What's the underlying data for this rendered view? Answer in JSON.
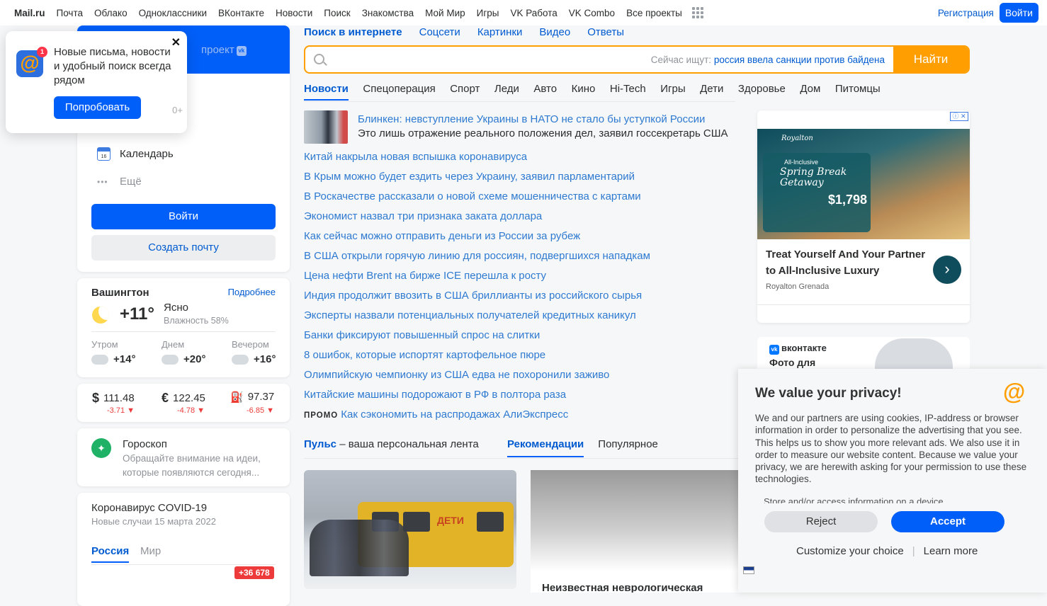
{
  "topnav": {
    "brand": "Mail.ru",
    "items": [
      "Почта",
      "Облако",
      "Одноклассники",
      "ВКонтакте",
      "Новости",
      "Поиск",
      "Знакомства",
      "Мой Мир",
      "Игры",
      "VK Работа",
      "VK Combo",
      "Все проекты"
    ],
    "register": "Регистрация",
    "login": "Войти"
  },
  "mail": {
    "project_label": "проект",
    "calendar": "Календарь",
    "more": "Ещё",
    "login": "Войти",
    "create": "Создать почту"
  },
  "promo_popup": {
    "badge": "1",
    "text": "Новые письма, новости и удобный поиск всегда рядом",
    "button": "Попробовать",
    "age": "0+"
  },
  "weather": {
    "city": "Вашингтон",
    "more": "Подробнее",
    "temp": "+11°",
    "condition": "Ясно",
    "humidity": "Влажность 58%",
    "parts": [
      {
        "label": "Утром",
        "temp": "+14°"
      },
      {
        "label": "Днем",
        "temp": "+20°"
      },
      {
        "label": "Вечером",
        "temp": "+16°"
      }
    ]
  },
  "rates": [
    {
      "symbol": "$",
      "value": "111.48",
      "change": "-3.71 ▼"
    },
    {
      "symbol": "€",
      "value": "122.45",
      "change": "-4.78 ▼"
    },
    {
      "symbol": "⛽",
      "value": "97.37",
      "change": "-6.85 ▼"
    }
  ],
  "horoscope": {
    "title": "Гороскоп",
    "text": "Обращайте внимание на идеи, которые появляются сегодня..."
  },
  "covid": {
    "title": "Коронавирус COVID-19",
    "subtitle": "Новые случаи 15 марта 2022",
    "tab_russia": "Россия",
    "tab_world": "Мир",
    "badge": "+36 678"
  },
  "search": {
    "tabs": [
      "Поиск в интернете",
      "Соцсети",
      "Картинки",
      "Видео",
      "Ответы"
    ],
    "hint_prefix": "Сейчас ищут:",
    "hint_query": "россия ввела санкции против байдена",
    "button": "Найти"
  },
  "categories": [
    "Новости",
    "Спецоперация",
    "Спорт",
    "Леди",
    "Авто",
    "Кино",
    "Hi-Tech",
    "Игры",
    "Дети",
    "Здоровье",
    "Дом",
    "Питомцы"
  ],
  "top_news": {
    "headline": "Блинкен: невступление Украины в НАТО не стало бы уступкой России",
    "description": "Это лишь отражение реального положения дел, заявил госсекретарь США"
  },
  "news": [
    "Китай накрыла новая вспышка коронавируса",
    "В Крым можно будет ездить через Украину, заявил парламентарий",
    "В Роскачестве рассказали о новой схеме мошенничества с картами",
    "Экономист назвал три признака заката доллара",
    "Как сейчас можно отправить деньги из России за рубеж",
    "В США открыли горячую линию для россиян, подвергшихся нападкам",
    "Цена нефти Brent на бирже ICE перешла к росту",
    "Индия продолжит ввозить в США бриллианты из российского сырья",
    "Эксперты назвали потенциальных получателей кредитных каникул",
    "Банки фиксируют повышенный спрос на слитки",
    "8 ошибок, которые испортят картофельное пюре",
    "Олимпийскую чемпионку из США едва не похоронили заживо",
    "Китайские машины подорожают в РФ в полтора раза"
  ],
  "promo_news": {
    "label": "ПРОМО",
    "text": "Как сэкономить на распродажах АлиЭкспресс"
  },
  "pulse": {
    "title": "Пульс",
    "subtitle": "– ваша персональная лента",
    "tab_rec": "Рекомендации",
    "tab_pop": "Популярное",
    "card1_sign": "ДЕТИ",
    "card2_title": "Неизвестная неврологическая"
  },
  "ad": {
    "brand_logo": "Royalton",
    "offer_top": "All-Inclusive",
    "offer_title": "Spring Break Getaway",
    "price": "$1,798",
    "headline": "Treat Yourself And Your Partner to All-Inclusive Luxury",
    "advertiser": "Royalton Grenada",
    "choice": "ⓘ ✕"
  },
  "vk_ad": {
    "logo": "вконтакте",
    "text": "Фото для"
  },
  "cookie": {
    "title": "We value your privacy!",
    "body": "We and our partners are using cookies, IP-address or browser information in order to personalize the advertising that you see. This helps us to show you more relevant ads. We also use it in order to measure our website content. Because we value your privacy, we are herewith asking for your permission to use these technologies.",
    "store": "Store and/or access information on a device",
    "reject": "Reject",
    "accept": "Accept",
    "customize": "Customize your choice",
    "learn": "Learn more"
  }
}
